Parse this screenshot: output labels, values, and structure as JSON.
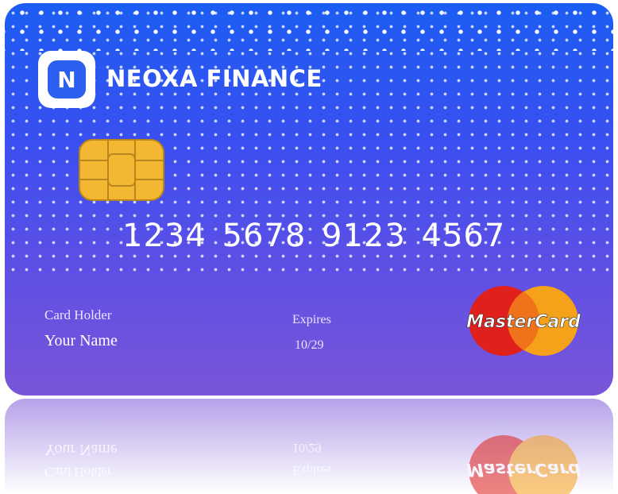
{
  "card": {
    "brand_name": "NEOXA FINANCE",
    "logo_letter": "N",
    "number": "1234 5678 9123 4567",
    "holder_label": "Card Holder",
    "holder_name": "Your Name",
    "expires_label": "Expires",
    "expires_value": "10/29",
    "network": "MasterCard",
    "colors": {
      "gradient_top": "#1b5df2",
      "gradient_bottom": "#7a55d8",
      "chip": "#f3b731",
      "mc_red": "#e0201b",
      "mc_orange": "#f6a11a"
    }
  }
}
